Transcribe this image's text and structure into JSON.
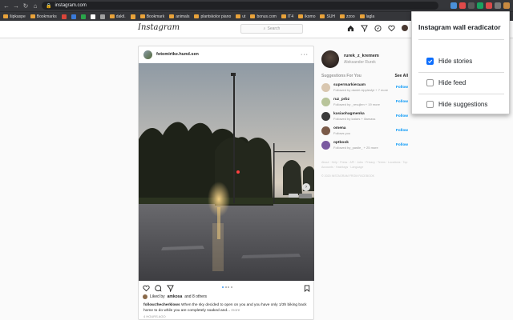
{
  "browser": {
    "url": "instagram.com",
    "bookmarks": [
      "šipkaspe",
      "Bookmarks",
      "",
      "",
      "",
      "",
      "",
      "daktl.",
      "",
      "Bookmark",
      "animals",
      "plantskolor piano",
      "ut",
      "bonus.com",
      "IT4",
      "ikomo",
      "SUH",
      "zzoo",
      "lagla"
    ]
  },
  "instagram": {
    "logo": "Instagram",
    "search_placeholder": "Search",
    "post": {
      "username": "fotomirtke.hund.sen",
      "liked_by_prefix": "Liked by",
      "liked_by_user": "amkosa",
      "liked_by_suffix": "and 8 others",
      "caption_user": "follow.thecherklows",
      "caption_text": "When the sky decided to open on you and you have only 1/3h biking back home to do while you are completely soaked and...",
      "caption_more": "more",
      "time": "4 hours ago"
    },
    "sidebar": {
      "username": "rurek_z_kremem",
      "fullname": "Aleksander Rurek",
      "suggestions_title": "Suggestions For You",
      "see_all": "See All",
      "suggestions": [
        {
          "user": "supermarkieraam",
          "sub": "Followed by daniel.nipplesfyt + 7 more",
          "follow": "Follow",
          "color": "#d9c7b0"
        },
        {
          "user": "ruz_prbz",
          "sub": "Followed by _revujlen + 19 more",
          "follow": "Follow",
          "color": "#b8c49a"
        },
        {
          "user": "kasiaohagmenka",
          "sub": "Followed by katars + illamass",
          "follow": "Follow",
          "color": "#3a3a3a"
        },
        {
          "user": "omena",
          "sub": "Follows you",
          "follow": "Follow",
          "color": "#7a5a48"
        },
        {
          "user": "optbook",
          "sub": "Followed by_pastle_ + 25 more",
          "follow": "Follow",
          "color": "#7a5aa0"
        }
      ],
      "footer_links": "About · Help · Press · API · Jobs · Privacy · Terms · Locations · Top Accounts · Hashtags · Language",
      "copyright": "© 2020 INSTAGRAM FROM FACEBOOK"
    }
  },
  "extension_popup": {
    "title": "Instagram wall eradicator",
    "options": [
      {
        "label": "Hide stories",
        "checked": true
      },
      {
        "label": "Hide feed",
        "checked": false
      },
      {
        "label": "Hide suggestions",
        "checked": false
      }
    ]
  }
}
